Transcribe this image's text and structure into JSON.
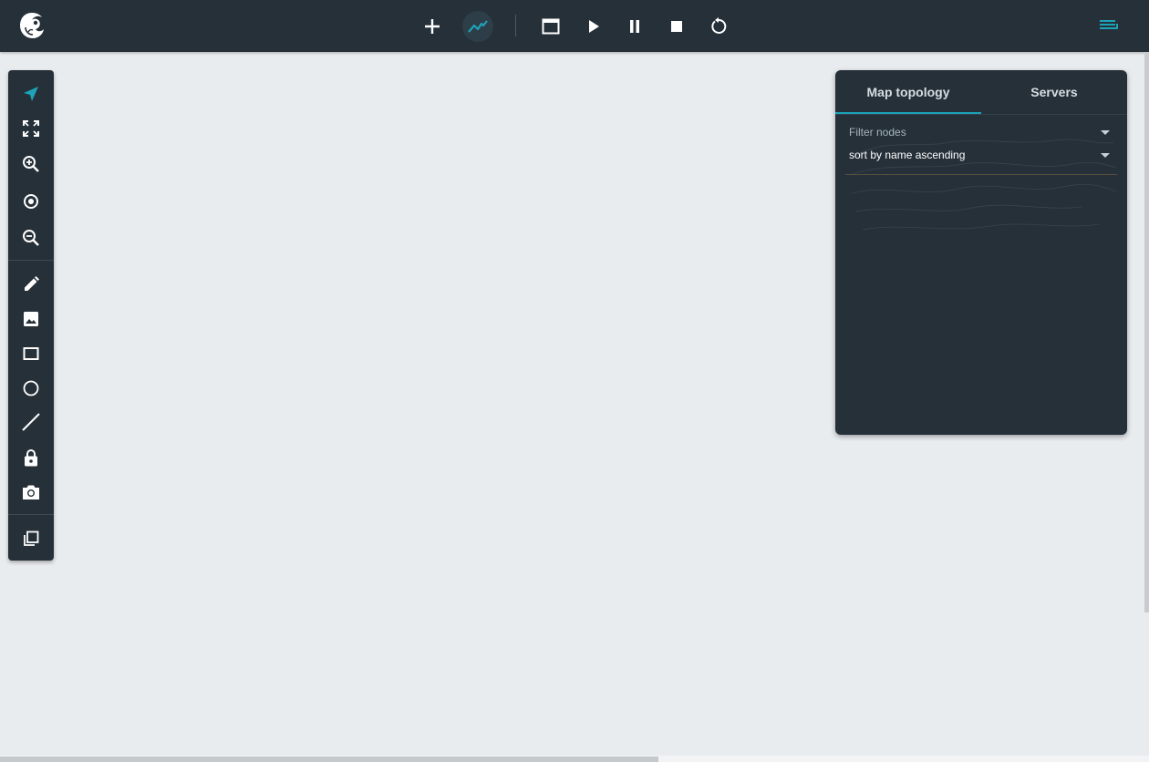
{
  "colors": {
    "topbar_bg": "#253039",
    "canvas_bg": "#e9ecef",
    "accent": "#1da3b8",
    "icon": "#ffffff"
  },
  "topbar": {
    "logo_icon": "chameleon-logo-icon",
    "buttons": [
      {
        "name": "add-icon",
        "active": false
      },
      {
        "name": "chart-line-icon",
        "active": true
      },
      {
        "name": "console-window-icon",
        "active": false
      },
      {
        "name": "play-icon",
        "active": false
      },
      {
        "name": "pause-icon",
        "active": false
      },
      {
        "name": "stop-icon",
        "active": false
      },
      {
        "name": "reload-icon",
        "active": false
      }
    ],
    "menu_icon": "list-menu-icon"
  },
  "left_toolbar": {
    "tools": [
      "navigation-arrow-icon",
      "fit-screen-icon",
      "zoom-in-icon",
      "center-focus-icon",
      "zoom-out-icon",
      "pencil-icon",
      "image-icon",
      "rectangle-icon",
      "ellipse-icon",
      "line-icon",
      "lock-icon",
      "camera-icon",
      "copy-icon"
    ]
  },
  "panel": {
    "tabs": [
      {
        "label": "Map topology",
        "active": true
      },
      {
        "label": "Servers",
        "active": false
      }
    ],
    "filter": {
      "placeholder": "Filter nodes",
      "value": ""
    },
    "sort": {
      "selected": "sort by name ascending"
    }
  }
}
